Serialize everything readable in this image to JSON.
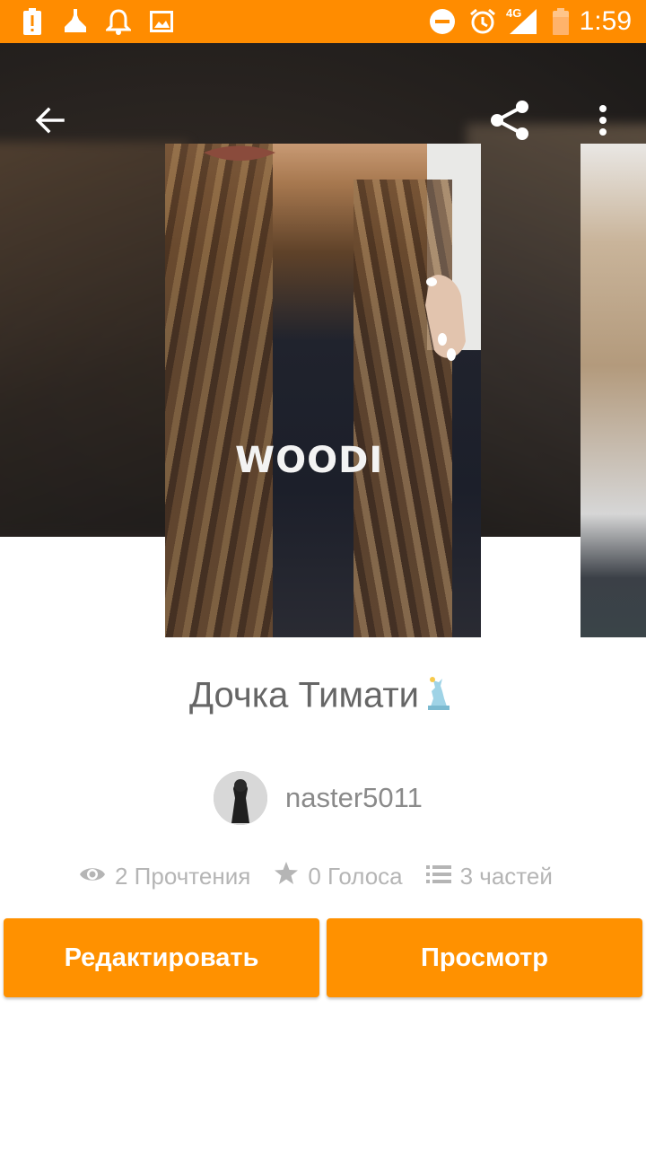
{
  "status_bar": {
    "time": "1:59",
    "network": "4G",
    "icons": [
      "battery-alert-icon",
      "cleaner-icon",
      "bell-icon",
      "image-icon",
      "do-not-disturb-icon",
      "alarm-icon",
      "signal-icon",
      "battery-icon"
    ]
  },
  "toolbar": {
    "back_icon": "arrow-back-icon",
    "share_icon": "share-icon",
    "more_icon": "more-vert-icon"
  },
  "cover": {
    "shirt_text": "WOODI"
  },
  "story": {
    "title": "Дочка Тимати",
    "author": "naster5011",
    "stats": {
      "reads": "2 Прочтения",
      "votes": "0 Голоса",
      "parts": "3 частей"
    }
  },
  "buttons": {
    "edit": "Редактировать",
    "view": "Просмотр"
  },
  "colors": {
    "accent": "#ff9100",
    "status_bar": "#ff8c00",
    "title_text": "#666666",
    "stats_text": "#b5b5b5"
  }
}
